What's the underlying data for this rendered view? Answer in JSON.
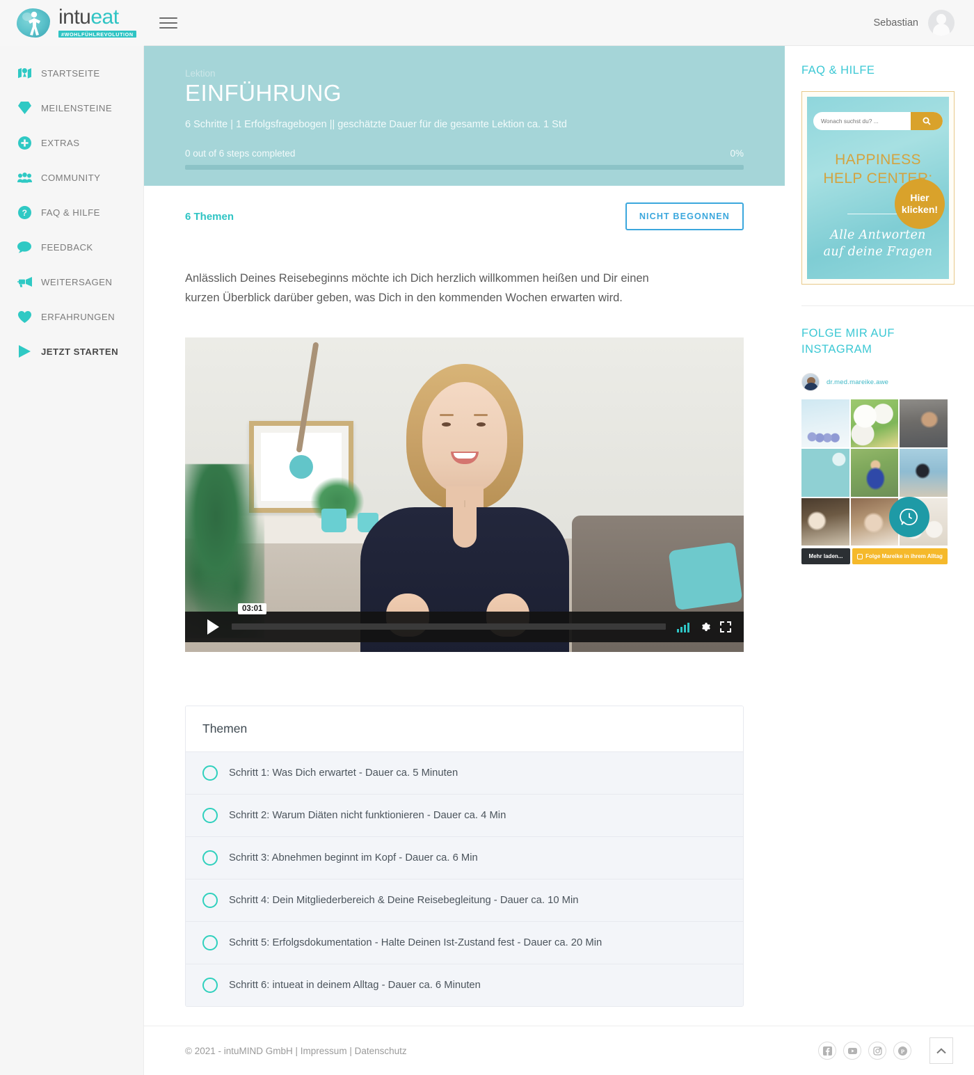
{
  "brand": {
    "name_part1": "intu",
    "name_part2": "eat",
    "tagline": "#WOHLFÜHLREVOLUTION"
  },
  "topbar": {
    "menu_icon": "hamburger-icon",
    "user_name": "Sebastian",
    "avatar_icon": "user-avatar"
  },
  "sidebar": {
    "items": [
      {
        "label": "STARTSEITE",
        "icon": "home-map-icon",
        "active": false
      },
      {
        "label": "MEILENSTEINE",
        "icon": "gem-icon",
        "active": false
      },
      {
        "label": "EXTRAS",
        "icon": "plus-circle-icon",
        "active": false
      },
      {
        "label": "COMMUNITY",
        "icon": "users-icon",
        "active": false
      },
      {
        "label": "FAQ & HILFE",
        "icon": "question-circle-icon",
        "active": false
      },
      {
        "label": "FEEDBACK",
        "icon": "comment-icon",
        "active": false
      },
      {
        "label": "WEITERSAGEN",
        "icon": "bullhorn-icon",
        "active": false
      },
      {
        "label": "ERFAHRUNGEN",
        "icon": "heart-icon",
        "active": false
      },
      {
        "label": "JETZT STARTEN",
        "icon": "play-icon",
        "active": true
      }
    ]
  },
  "hero": {
    "eyebrow": "Lektion",
    "title": "EINFÜHRUNG",
    "subtitle": "6 Schritte | 1 Erfolgsfragebogen || geschätzte Dauer für die gesamte Lektion ca. 1 Std",
    "progress_text": "0 out of 6 steps completed",
    "progress_percent_label": "0%",
    "progress_percent": 0,
    "bg_color": "#a5d5d8"
  },
  "meta": {
    "topics_count": "6 Themen",
    "status_button": "NICHT BEGONNEN",
    "status_color": "#3ba7dd"
  },
  "intro": {
    "paragraph": "Anlässlich Deines Reisebeginns möchte ich Dich herzlich willkommen heißen und Dir einen kurzen Überblick darüber geben, was Dich in den kommenden Wochen erwarten wird."
  },
  "video": {
    "duration": "03:01",
    "play_icon": "play-icon",
    "volume_icon": "volume-bars-icon",
    "settings_icon": "gear-icon",
    "fullscreen_icon": "fullscreen-icon",
    "progress_percent": 0
  },
  "topics": {
    "heading": "Themen",
    "items": [
      {
        "label": "Schritt 1: Was Dich erwartet - Dauer ca. 5 Minuten",
        "status": "not-started"
      },
      {
        "label": "Schritt 2: Warum Diäten nicht funktionieren - Dauer ca. 4 Min",
        "status": "not-started"
      },
      {
        "label": "Schritt 3: Abnehmen beginnt im Kopf - Dauer ca. 6 Min",
        "status": "not-started"
      },
      {
        "label": "Schritt 4: Dein Mitgliederbereich & Deine Reisebegleitung - Dauer ca. 10 Min",
        "status": "not-started"
      },
      {
        "label": "Schritt 5: Erfolgsdokumentation - Halte Deinen Ist-Zustand fest - Dauer ca. 20 Min",
        "status": "not-started"
      },
      {
        "label": "Schritt 6: intueat in deinem Alltag - Dauer ca. 6 Minuten",
        "status": "not-started"
      }
    ]
  },
  "rightbar": {
    "faq_title": "FAQ & HILFE",
    "promo": {
      "search_placeholder": "Wonach suchst du? ...",
      "search_icon": "search-icon",
      "headline_line1": "HAPPINESS",
      "headline_line2": "HELP CENTER:",
      "script_line1": "Alle Antworten",
      "script_line2": "auf deine Fragen",
      "badge_line1": "Hier",
      "badge_line2": "klicken!",
      "badge_color": "#d9a22b"
    },
    "instagram_title_line1": "FOLGE MIR AUF",
    "instagram_title_line2": "INSTAGRAM",
    "instagram_handle": "dr.med.mareike.awe",
    "instagram_badge_icon": "clock-chat-icon",
    "load_more_label": "Mehr laden...",
    "follow_label": "Folge Mareike in ihrem Alltag",
    "follow_icon": "instagram-icon"
  },
  "footer": {
    "copyright": "© 2021 - intuMIND GmbH",
    "link_imprint": "Impressum",
    "link_privacy": "Datenschutz",
    "separator": "|",
    "social": [
      {
        "name": "facebook-icon",
        "label": "f"
      },
      {
        "name": "youtube-icon",
        "label": "▶"
      },
      {
        "name": "instagram-icon",
        "label": "◎"
      },
      {
        "name": "pinterest-icon",
        "label": "P"
      }
    ],
    "scroll_top_icon": "chevron-up-icon"
  },
  "theme": {
    "accent_teal": "#2fc4c4",
    "hero_teal": "#a5d5d8",
    "circle_teal": "#2fd0bd",
    "blue": "#3ba7dd",
    "gold": "#d9a22b"
  }
}
